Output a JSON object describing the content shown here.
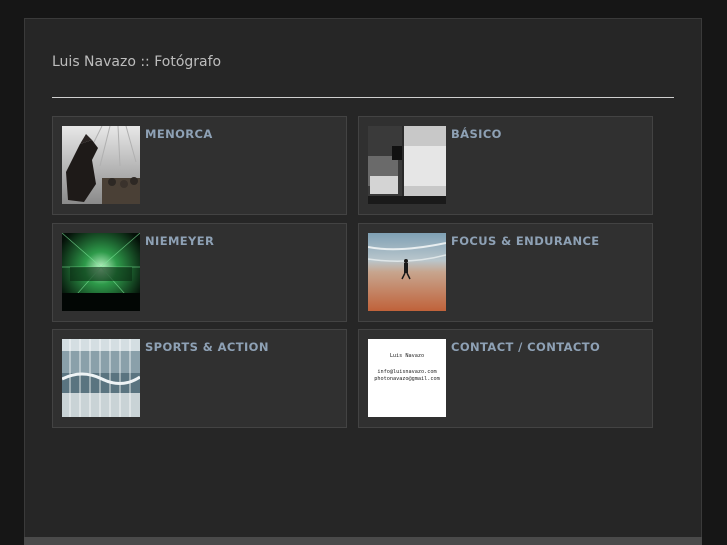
{
  "site": {
    "title": "Luis Navazo :: Fotógrafo"
  },
  "galleries": [
    {
      "label": "MENORCA",
      "thumb_icon": "horse-photo-thumbnail"
    },
    {
      "label": "BÁSICO",
      "thumb_icon": "black-white-abstract-thumbnail"
    },
    {
      "label": "NIEMEYER",
      "thumb_icon": "green-corridor-thumbnail"
    },
    {
      "label": "FOCUS & ENDURANCE",
      "thumb_icon": "beach-runner-thumbnail"
    },
    {
      "label": "SPORTS & ACTION",
      "thumb_icon": "surf-sequence-thumbnail"
    },
    {
      "label": "CONTACT / CONTACTO",
      "thumb_icon": "contact-card-thumbnail"
    }
  ],
  "contact_card": {
    "name": "Luis Navazo",
    "email1": "info@luisnavazo.com",
    "email2": "photonavazo@gmail.com"
  },
  "colors": {
    "page_bg": "#161616",
    "panel_bg": "#262626",
    "card_bg": "#303030",
    "link": "#8ea1b5"
  }
}
